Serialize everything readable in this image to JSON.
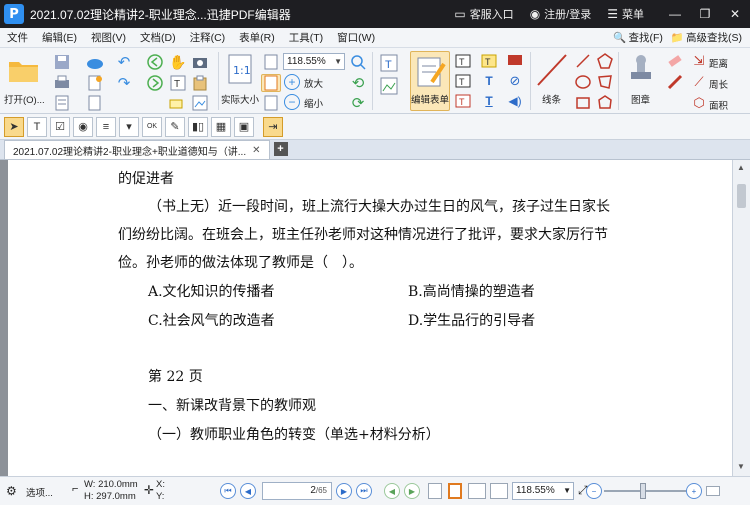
{
  "window": {
    "title": "2021.07.02理论精讲2-职业理念...迅捷PDF编辑器",
    "logo_letter": "P",
    "links": [
      {
        "label": "客服入口",
        "icon": "chat-icon"
      },
      {
        "label": "注册/登录",
        "icon": "user-icon"
      },
      {
        "label": "菜单",
        "icon": "menu-icon"
      }
    ],
    "controls": [
      "minimize",
      "restore",
      "close"
    ]
  },
  "menu": {
    "items": [
      "文件",
      "编辑(E)",
      "视图(V)",
      "文档(D)",
      "注释(C)",
      "表单(R)",
      "工具(T)",
      "窗口(W)"
    ],
    "right": [
      {
        "label": "查找(F)",
        "icon": "find-icon"
      },
      {
        "label": "高级查找(S)",
        "icon": "advanced-find-icon"
      }
    ]
  },
  "ribbon": {
    "open_label": "打开(O)...",
    "zoom_value": "118.55%",
    "actual_size_label": "实际大小",
    "zoom_in_label": "放大",
    "zoom_out_label": "缩小",
    "edit_form_label": "编辑表单",
    "lines_label": "线条",
    "stamp_label": "图章",
    "distance_label": "距离",
    "perimeter_label": "周长",
    "area_label": "面积",
    "accent_color": "#f5a623"
  },
  "tab": {
    "label": "2021.07.02理论精讲2-职业理念+职业道德知与（讲...",
    "close": "✕",
    "add": "+"
  },
  "document": {
    "lines": [
      "的促进者",
      "（书上无）近一段时间，班上流行大操大办过生日的风气，孩子过生日家长",
      "们纷纷比阔。在班会上，班主任孙老师对这种情况进行了批评，要求大家厉行节",
      "俭。孙老师的做法体现了教师是（　）。"
    ],
    "options": {
      "a": "A.文化知识的传播者",
      "b": "B.高尚情操的塑造者",
      "c": "C.社会风气的改造者",
      "d": "D.学生品行的引导者"
    },
    "page_heading": "第 22 页",
    "section_1": "一、新课改背景下的教师观",
    "section_2": "（一）教师职业角色的转变（单选+材料分析）"
  },
  "status": {
    "options_label": "选项...",
    "width": "W: 210.0mm",
    "height": "H: 297.0mm",
    "x_label": "X:",
    "y_label": "Y:",
    "current_page": "2",
    "total_pages": "/65",
    "zoom_value": "118.55%"
  }
}
